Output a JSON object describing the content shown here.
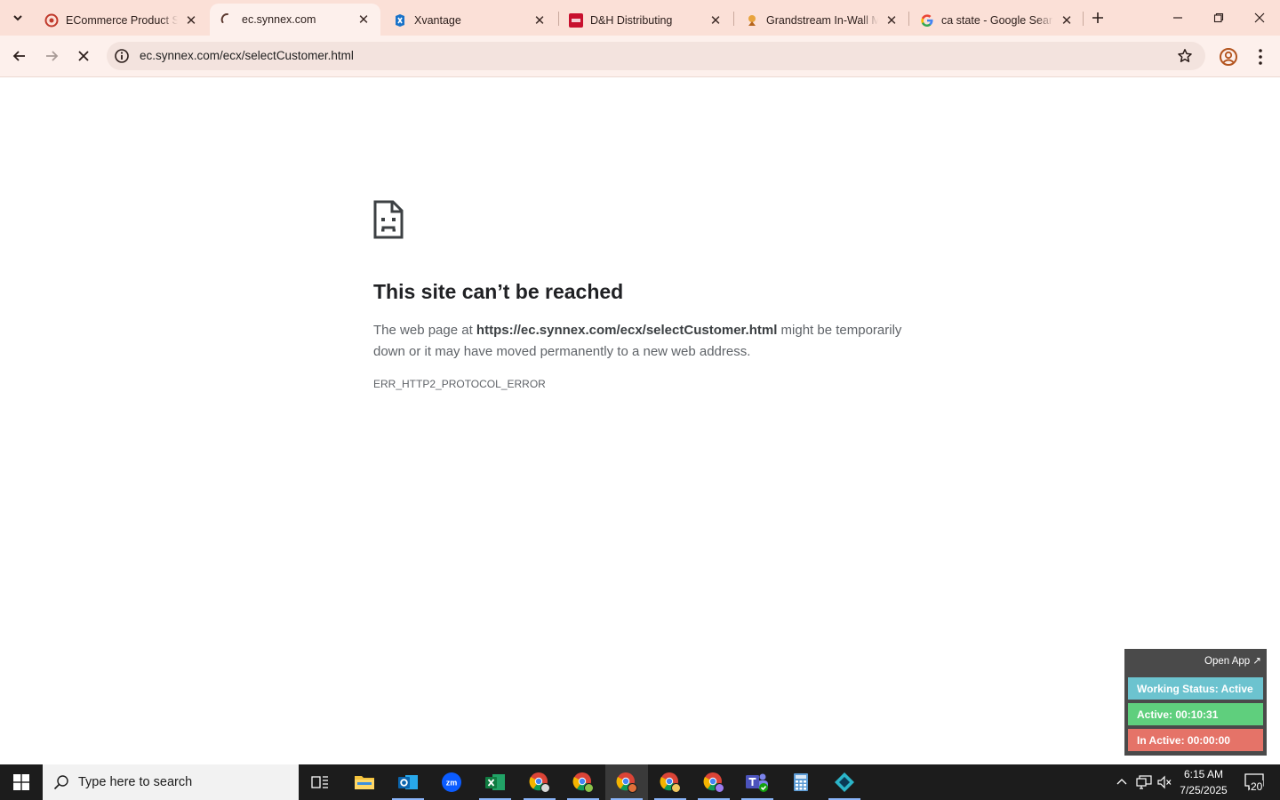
{
  "browser": {
    "tabs": [
      {
        "title": "ECommerce Product Se",
        "favicon": "ecommerce-favicon-icon",
        "active": false
      },
      {
        "title": "ec.synnex.com",
        "favicon": "loading-spinner-icon",
        "active": true
      },
      {
        "title": "Xvantage",
        "favicon": "xvantage-favicon-icon",
        "active": false
      },
      {
        "title": "D&H Distributing",
        "favicon": "dh-favicon-icon",
        "active": false
      },
      {
        "title": "Grandstream In-Wall M",
        "favicon": "grandstream-favicon-icon",
        "active": false
      },
      {
        "title": "ca state - Google Searc",
        "favicon": "google-favicon-icon",
        "active": false
      }
    ],
    "url": "ec.synnex.com/ecx/selectCustomer.html",
    "accent": "#fbe0d7"
  },
  "error": {
    "title": "This site can’t be reached",
    "body_prefix": "The web page at ",
    "body_url": "https://ec.synnex.com/ecx/selectCustomer.html",
    "body_suffix": " might be temporarily down or it may have moved permanently to a new web address.",
    "code": "ERR_HTTP2_PROTOCOL_ERROR"
  },
  "widget": {
    "open_app": "Open App ↗",
    "working_status": "Working Status: Active",
    "active": "Active: 00:10:31",
    "inactive": "In Active: 00:00:00",
    "colors": {
      "status": "#6cc3cf",
      "active": "#5fcf7d",
      "inactive": "#e57368"
    }
  },
  "taskbar": {
    "search_placeholder": "Type here to search",
    "time": "6:15 AM",
    "date": "7/25/2025",
    "notifications": "20"
  }
}
